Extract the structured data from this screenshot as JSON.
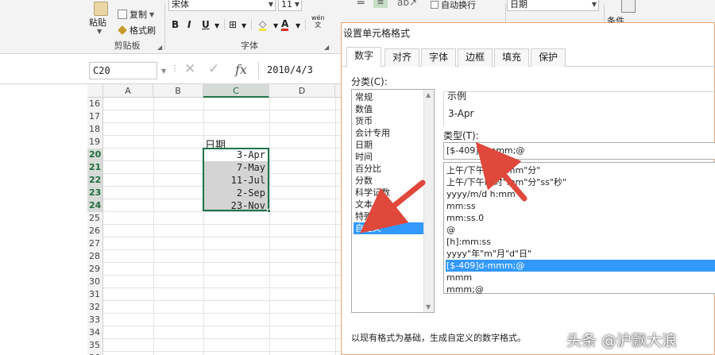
{
  "ribbon": {
    "clipboard": {
      "paste_label": "粘贴",
      "copy_label": "复制",
      "format_painter_label": "格式刷",
      "group_label": "剪贴板"
    },
    "font": {
      "font_name": "宋体",
      "font_size": "11",
      "bold": "B",
      "italic": "I",
      "underline": "U",
      "phonetic": "wén",
      "group_label": "字体"
    },
    "alignment": {
      "wrap_text_label": "自动换行"
    },
    "number": {
      "format_value": "日期"
    },
    "styles": {
      "conditional_partial": "条件"
    }
  },
  "formula_bar": {
    "name_box": "C20",
    "fx": "fx",
    "formula": "2010/4/3"
  },
  "sheet": {
    "columns": [
      "A",
      "B",
      "C",
      "D"
    ],
    "active_column": "C",
    "rows": [
      "16",
      "17",
      "18",
      "19",
      "20",
      "21",
      "22",
      "23",
      "24",
      "25",
      "26",
      "27",
      "28",
      "29",
      "30",
      "31",
      "32",
      "33",
      "34",
      "35",
      "36"
    ],
    "header_cell": "日期",
    "dates": [
      "3-Apr",
      "7-May",
      "11-Jul",
      "2-Sep",
      "23-Nov"
    ]
  },
  "dialog": {
    "title": "设置单元格格式",
    "tabs": [
      "数字",
      "对齐",
      "字体",
      "边框",
      "填充",
      "保护"
    ],
    "category_label": "分类(C):",
    "categories": [
      "常规",
      "数值",
      "货币",
      "会计专用",
      "日期",
      "时间",
      "百分比",
      "分数",
      "科学记数",
      "文本",
      "特殊",
      "自定义"
    ],
    "selected_category": "自定义",
    "sample_label": "示例",
    "sample_value": "3-Apr",
    "type_label": "类型(T):",
    "type_value": "[$-409]d-mmm;@",
    "formats": [
      "上午/下午h\"时\"mm\"分\"",
      "上午/下午h\"时\"mm\"分\"ss\"秒\"",
      "yyyy/m/d h:mm",
      "mm:ss",
      "mm:ss.0",
      "@",
      "[h]:mm:ss",
      "yyyy\"年\"m\"月\"d\"日\"",
      "[$-409]d-mmm;@",
      "mmm",
      "mmm;@"
    ],
    "selected_format": "[$-409]d-mmm;@",
    "description": "以现有格式为基础，生成自定义的数字格式。"
  },
  "annotation_color": "#e0483c",
  "watermark": "头条 @沪飘大浪"
}
